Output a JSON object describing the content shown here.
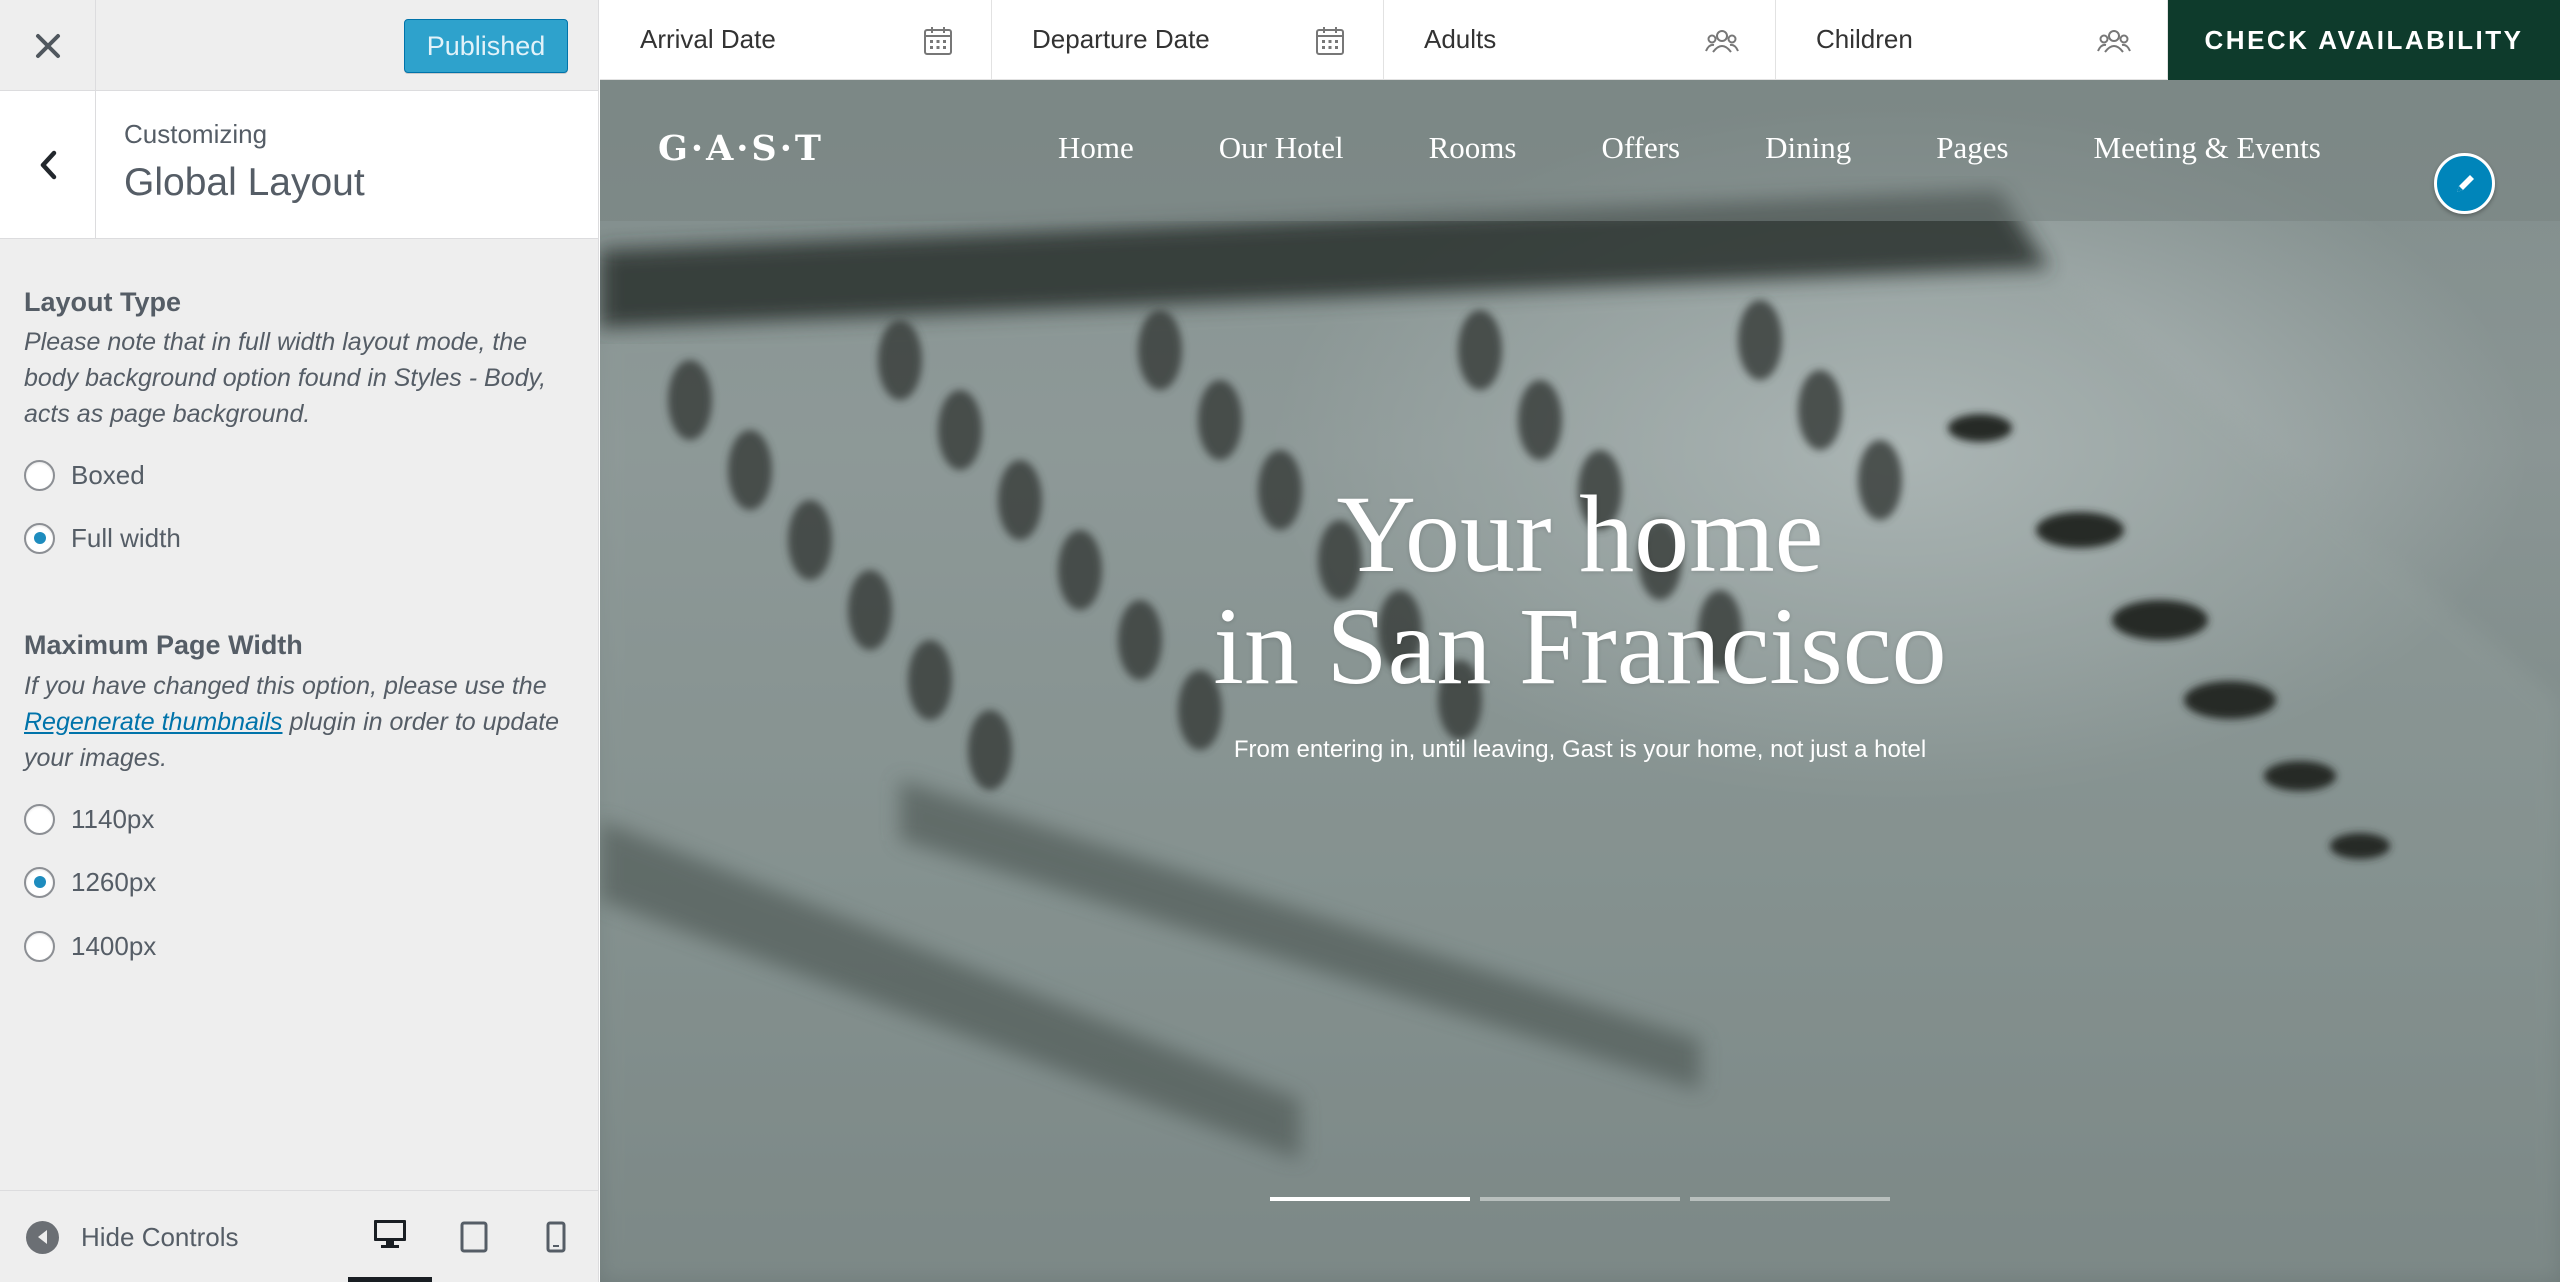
{
  "panel": {
    "publish_label": "Published",
    "customizing_label": "Customizing",
    "section_title": "Global Layout",
    "layout_type": {
      "title": "Layout Type",
      "description": "Please note that in full width layout mode, the body background option found in Styles - Body, acts as page background.",
      "options": [
        {
          "label": "Boxed",
          "checked": false
        },
        {
          "label": "Full width",
          "checked": true
        }
      ]
    },
    "max_width": {
      "title": "Maximum Page Width",
      "desc_before": "If you have changed this option, please use the ",
      "desc_link": "Regenerate thumbnails",
      "desc_after": " plugin in order to update your images.",
      "options": [
        {
          "label": "1140px",
          "checked": false
        },
        {
          "label": "1260px",
          "checked": true
        },
        {
          "label": "1400px",
          "checked": false
        }
      ]
    },
    "footer": {
      "hide_controls_label": "Hide Controls",
      "active_device": "desktop"
    }
  },
  "booking": {
    "fields": [
      {
        "label": "Arrival Date",
        "icon": "calendar-icon"
      },
      {
        "label": "Departure Date",
        "icon": "calendar-icon"
      },
      {
        "label": "Adults",
        "icon": "people-icon"
      },
      {
        "label": "Children",
        "icon": "people-icon"
      }
    ],
    "check_label": "CHECK AVAILABILITY"
  },
  "site": {
    "logo": "G·A·S·T",
    "nav": [
      "Home",
      "Our Hotel",
      "Rooms",
      "Offers",
      "Dining",
      "Pages",
      "Meeting & Events"
    ]
  },
  "hero": {
    "title_line1": "Your home",
    "title_line2": "in San Francisco",
    "subtitle": "From entering in, until leaving, Gast is your home, not just a hotel",
    "slides": 3,
    "active_slide": 0
  },
  "colors": {
    "publish": "#2ea2cc",
    "check_availability": "#0e3b2c",
    "radio_checked": "#1e8cbe",
    "edit_shortcut": "#0085ba"
  }
}
